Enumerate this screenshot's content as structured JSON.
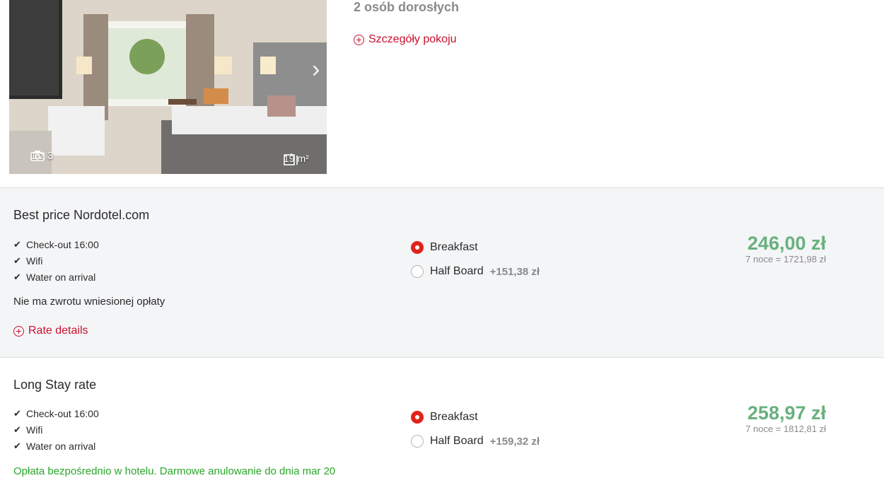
{
  "room": {
    "occupancy": "2 osób dorosłych",
    "details_link": "Szczegóły pokoju",
    "photo": {
      "counter": "1 z 3",
      "area": "19 m²",
      "camera_icon": "camera-icon",
      "area_icon": "room-size-icon",
      "next_icon": "chevron-right-icon"
    }
  },
  "rates": [
    {
      "title": "Best price Nordotel.com",
      "features": [
        "Check-out 16:00",
        "Wifi",
        "Water on arrival"
      ],
      "policy": "Nie ma zwrotu wniesionej opłaty",
      "details_link": "Rate details",
      "boards": [
        {
          "label": "Breakfast",
          "surcharge": "",
          "selected": true
        },
        {
          "label": "Half Board",
          "surcharge": "+151,38 zł",
          "selected": false
        }
      ],
      "price": "246,00 zł",
      "total": "7 noce = 1721,98 zł"
    },
    {
      "title": "Long Stay rate",
      "features": [
        "Check-out 16:00",
        "Wifi",
        "Water on arrival"
      ],
      "policy": "Opłata bezpośrednio w hotelu. Darmowe anulowanie do dnia mar 20",
      "boards": [
        {
          "label": "Breakfast",
          "surcharge": "",
          "selected": true
        },
        {
          "label": "Half Board",
          "surcharge": "+159,32 zł",
          "selected": false
        }
      ],
      "price": "258,97 zł",
      "total": "7 noce = 1812,81 zł"
    }
  ],
  "colors": {
    "accent_red": "#c8102e",
    "price_green": "#69b07d",
    "policy_green": "#2aa62a",
    "muted_grey": "#8a8a8a"
  }
}
